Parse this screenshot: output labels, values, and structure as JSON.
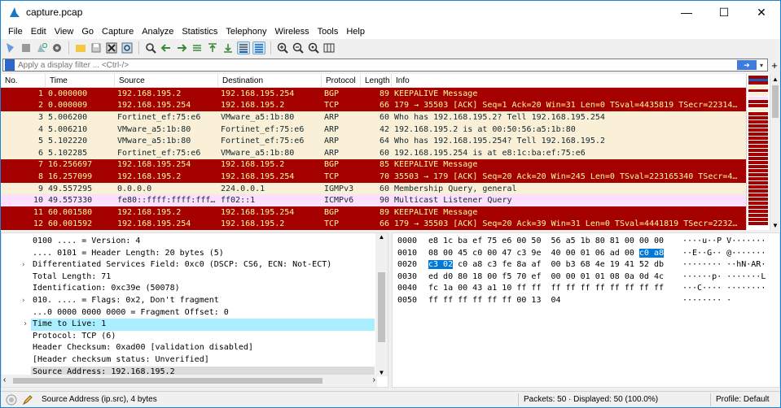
{
  "window": {
    "title": "capture.pcap"
  },
  "menu": [
    "File",
    "Edit",
    "View",
    "Go",
    "Capture",
    "Analyze",
    "Statistics",
    "Telephony",
    "Wireless",
    "Tools",
    "Help"
  ],
  "filter": {
    "placeholder": "Apply a display filter ... <Ctrl-/>",
    "value": ""
  },
  "columns": {
    "no": "No.",
    "time": "Time",
    "src": "Source",
    "dst": "Destination",
    "proto": "Protocol",
    "len": "Length",
    "info": "Info"
  },
  "packets": [
    {
      "no": "1",
      "time": "0.000000",
      "src": "192.168.195.2",
      "dst": "192.168.195.254",
      "proto": "BGP",
      "len": "89",
      "info": "KEEPALIVE Message",
      "style": "red"
    },
    {
      "no": "2",
      "time": "0.000009",
      "src": "192.168.195.254",
      "dst": "192.168.195.2",
      "proto": "TCP",
      "len": "66",
      "info": "179 → 35503 [ACK] Seq=1 Ack=20 Win=31 Len=0 TSval=4435819 TSecr=22314…",
      "style": "red"
    },
    {
      "no": "3",
      "time": "5.006200",
      "src": "Fortinet_ef:75:e6",
      "dst": "VMware_a5:1b:80",
      "proto": "ARP",
      "len": "60",
      "info": "Who has 192.168.195.2? Tell 192.168.195.254",
      "style": "tan"
    },
    {
      "no": "4",
      "time": "5.006210",
      "src": "VMware_a5:1b:80",
      "dst": "Fortinet_ef:75:e6",
      "proto": "ARP",
      "len": "42",
      "info": "192.168.195.2 is at 00:50:56:a5:1b:80",
      "style": "tan"
    },
    {
      "no": "5",
      "time": "5.102220",
      "src": "VMware_a5:1b:80",
      "dst": "Fortinet_ef:75:e6",
      "proto": "ARP",
      "len": "64",
      "info": "Who has 192.168.195.254? Tell 192.168.195.2",
      "style": "tan"
    },
    {
      "no": "6",
      "time": "5.102285",
      "src": "Fortinet_ef:75:e6",
      "dst": "VMware_a5:1b:80",
      "proto": "ARP",
      "len": "60",
      "info": "192.168.195.254 is at e8:1c:ba:ef:75:e6",
      "style": "tan"
    },
    {
      "no": "7",
      "time": "16.256697",
      "src": "192.168.195.254",
      "dst": "192.168.195.2",
      "proto": "BGP",
      "len": "85",
      "info": "KEEPALIVE Message",
      "style": "red"
    },
    {
      "no": "8",
      "time": "16.257099",
      "src": "192.168.195.2",
      "dst": "192.168.195.254",
      "proto": "TCP",
      "len": "70",
      "info": "35503 → 179 [ACK] Seq=20 Ack=20 Win=245 Len=0 TSval=223165340 TSecr=4…",
      "style": "red"
    },
    {
      "no": "9",
      "time": "49.557295",
      "src": "0.0.0.0",
      "dst": "224.0.0.1",
      "proto": "IGMPv3",
      "len": "60",
      "info": "Membership Query, general",
      "style": "tan"
    },
    {
      "no": "10",
      "time": "49.557330",
      "src": "fe80::ffff:ffff:fff…",
      "dst": "ff02::1",
      "proto": "ICMPv6",
      "len": "90",
      "info": "Multicast Listener Query",
      "style": "pink"
    },
    {
      "no": "11",
      "time": "60.001580",
      "src": "192.168.195.2",
      "dst": "192.168.195.254",
      "proto": "BGP",
      "len": "89",
      "info": "KEEPALIVE Message",
      "style": "red"
    },
    {
      "no": "12",
      "time": "60.001592",
      "src": "192.168.195.254",
      "dst": "192.168.195.2",
      "proto": "TCP",
      "len": "66",
      "info": "179 → 35503 [ACK] Seq=20 Ack=39 Win=31 Len=0 TSval=4441819 TSecr=2232…",
      "style": "red"
    }
  ],
  "details": [
    {
      "text": "0100 .... = Version: 4",
      "exp": false,
      "hl": ""
    },
    {
      "text": ".... 0101 = Header Length: 20 bytes (5)",
      "exp": false,
      "hl": ""
    },
    {
      "text": "Differentiated Services Field: 0xc0 (DSCP: CS6, ECN: Not-ECT)",
      "exp": true,
      "hl": ""
    },
    {
      "text": "Total Length: 71",
      "exp": false,
      "hl": ""
    },
    {
      "text": "Identification: 0xc39e (50078)",
      "exp": false,
      "hl": ""
    },
    {
      "text": "010. .... = Flags: 0x2, Don't fragment",
      "exp": true,
      "hl": ""
    },
    {
      "text": "...0 0000 0000 0000 = Fragment Offset: 0",
      "exp": false,
      "hl": ""
    },
    {
      "text": "Time to Live: 1",
      "exp": true,
      "hl": "cyan"
    },
    {
      "text": "Protocol: TCP (6)",
      "exp": false,
      "hl": ""
    },
    {
      "text": "Header Checksum: 0xad00 [validation disabled]",
      "exp": false,
      "hl": ""
    },
    {
      "text": "[Header checksum status: Unverified]",
      "exp": false,
      "hl": ""
    },
    {
      "text": "Source Address: 192.168.195.2",
      "exp": false,
      "hl": "gray"
    }
  ],
  "hex": [
    {
      "off": "0000",
      "b1": "e8 1c ba ef 75 e6 00 50  56 a5 1b 80 81 00 00 00",
      "a1": "····u··P V·······"
    },
    {
      "off": "0010",
      "b1": "08 00 45 c0 00 47 c3 9e  40 00 01 06 ad 00 ",
      "bh": "c0 a8",
      "a1": "··E··G·· @·······",
      "ah": ""
    },
    {
      "off": "0020",
      "bh2": "c3 02",
      "b1": " c0 a8 c3 fe 8a af  00 b3 68 4e 19 41 52 db",
      "a1": "········ ··hN·AR·"
    },
    {
      "off": "0030",
      "b1": "ed d0 80 18 00 f5 70 ef  00 00 01 01 08 0a 0d 4c",
      "a1": "······p· ·······L"
    },
    {
      "off": "0040",
      "b1": "fc 1a 00 43 a1 10 ff ff  ff ff ff ff ff ff ff ff",
      "a1": "···C···· ········"
    },
    {
      "off": "0050",
      "b1": "ff ff ff ff ff ff 00 13  04",
      "a1": "········ ·"
    }
  ],
  "status": {
    "field": "Source Address (ip.src), 4 bytes",
    "packets": "Packets: 50 · Displayed: 50 (100.0%)",
    "profile": "Profile: Default"
  }
}
